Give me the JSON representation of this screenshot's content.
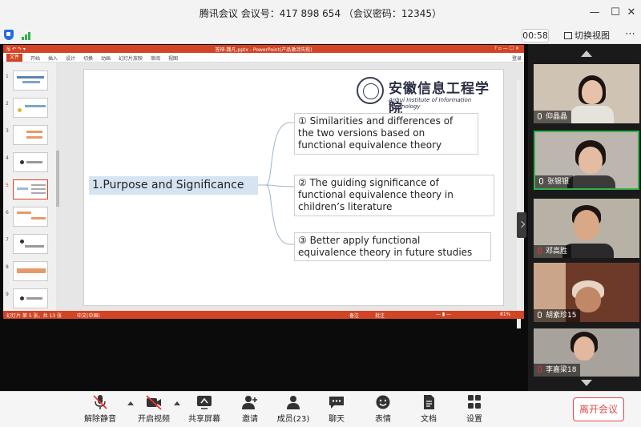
{
  "window": {
    "title": "腾讯会议 会议号：417 898 654 （会议密码：12345）",
    "minimize": "—",
    "maximize": "☐",
    "close": "✕"
  },
  "toolbar": {
    "timer": "00:58",
    "switch_view": "切换视图",
    "more": "⋯"
  },
  "ppt": {
    "title": "答辩-魏凡.pptx - PowerPoint(产品激活失败)",
    "quick_access": "🖫 ↶ ↷ ▾",
    "window_controls": "? ▫ — ☐ ✕",
    "ribbon_tabs": [
      "文件",
      "开始",
      "插入",
      "设计",
      "切换",
      "动画",
      "幻灯片放映",
      "审阅",
      "视图"
    ],
    "login": "登录",
    "thumbnails": [
      "1",
      "2",
      "3",
      "4",
      "5",
      "6",
      "7",
      "8",
      "9"
    ],
    "selected_thumbnail": "5",
    "slide": {
      "logo_cn": "安徽信息工程学院",
      "logo_en": "Anhui Institute of Information Technology",
      "heading": "1.Purpose and Significance",
      "points": [
        {
          "line1": "① Similarities and differences of",
          "line2": "the two versions based  on",
          "line3": "functional equivalence theory"
        },
        {
          "line1": "② The guiding significance of",
          "line2": "functional equivalence theory in",
          "line3": "children’s literature"
        },
        {
          "line1": "③ Better apply functional",
          "line2": "equivalence theory in future studies",
          "line3": ""
        }
      ]
    },
    "status": {
      "slide_info": "幻灯片 第 5 张，共 13 张",
      "language": "中文(中国)",
      "notes": "备注",
      "comments": "批注",
      "zoom": "81%"
    }
  },
  "participants": [
    {
      "name": "仰晶晶",
      "mic": "on",
      "active": false
    },
    {
      "name": "张银银",
      "mic": "on",
      "active": true
    },
    {
      "name": "邓高胜",
      "mic": "off",
      "active": false
    },
    {
      "name": "胡紊珍15",
      "mic": "on",
      "active": false
    },
    {
      "name": "李嘉梁18",
      "mic": "off",
      "active": false
    }
  ],
  "bottombar": {
    "items": [
      {
        "id": "mute",
        "label": "解除静音"
      },
      {
        "id": "video",
        "label": "开启视频"
      },
      {
        "id": "share",
        "label": "共享屏幕"
      },
      {
        "id": "invite",
        "label": "邀请"
      },
      {
        "id": "members",
        "label": "成员(23)"
      },
      {
        "id": "chat",
        "label": "聊天"
      },
      {
        "id": "reactions",
        "label": "表情"
      },
      {
        "id": "docs",
        "label": "文档"
      },
      {
        "id": "settings",
        "label": "设置"
      }
    ],
    "leave": "离开会议"
  },
  "colors": {
    "ppt_accent": "#d14424",
    "active_speaker": "#2fb24a",
    "leave": "#e04a4a",
    "heading_bg": "#d6e3f1"
  }
}
